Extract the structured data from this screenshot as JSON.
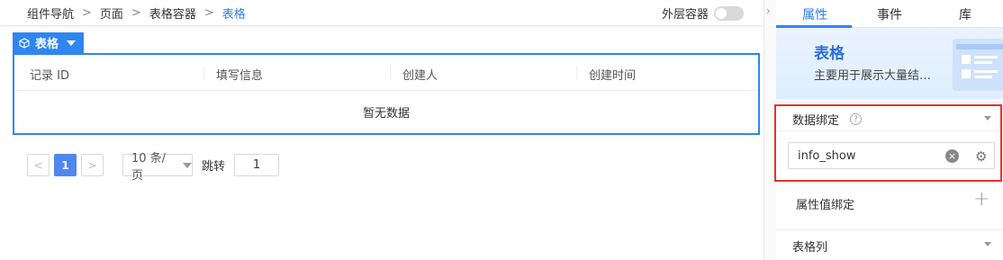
{
  "breadcrumb": [
    "组件导航",
    "页面",
    "表格容器",
    "表格"
  ],
  "breadcrumb_sep": ">",
  "outer_container": {
    "label": "外层容器",
    "enabled": false
  },
  "component_chip": {
    "label": "表格",
    "icon": "cube-icon"
  },
  "table": {
    "columns": [
      "记录 ID",
      "填写信息",
      "创建人",
      "创建时间"
    ],
    "empty_text": "暂无数据"
  },
  "pagination": {
    "prev": "<",
    "current_page": "1",
    "next": ">",
    "page_size": "10 条/页",
    "jump_label": "跳转",
    "jump_value": "1"
  },
  "panel": {
    "collapse_arrow": "›",
    "tabs": [
      "属性",
      "事件",
      "库"
    ],
    "active_tab": "属性",
    "hero": {
      "title": "表格",
      "desc": "主要用于展示大量结…"
    },
    "data_binding": {
      "label": "数据绑定",
      "help": "?",
      "value": "info_show",
      "clear": "×",
      "settings": "⚙"
    },
    "attr_binding": {
      "label": "属性值绑定",
      "add": "+"
    },
    "table_columns": {
      "label": "表格列"
    }
  },
  "colors": {
    "accent": "#2f86f0",
    "highlight": "#e5322d"
  }
}
